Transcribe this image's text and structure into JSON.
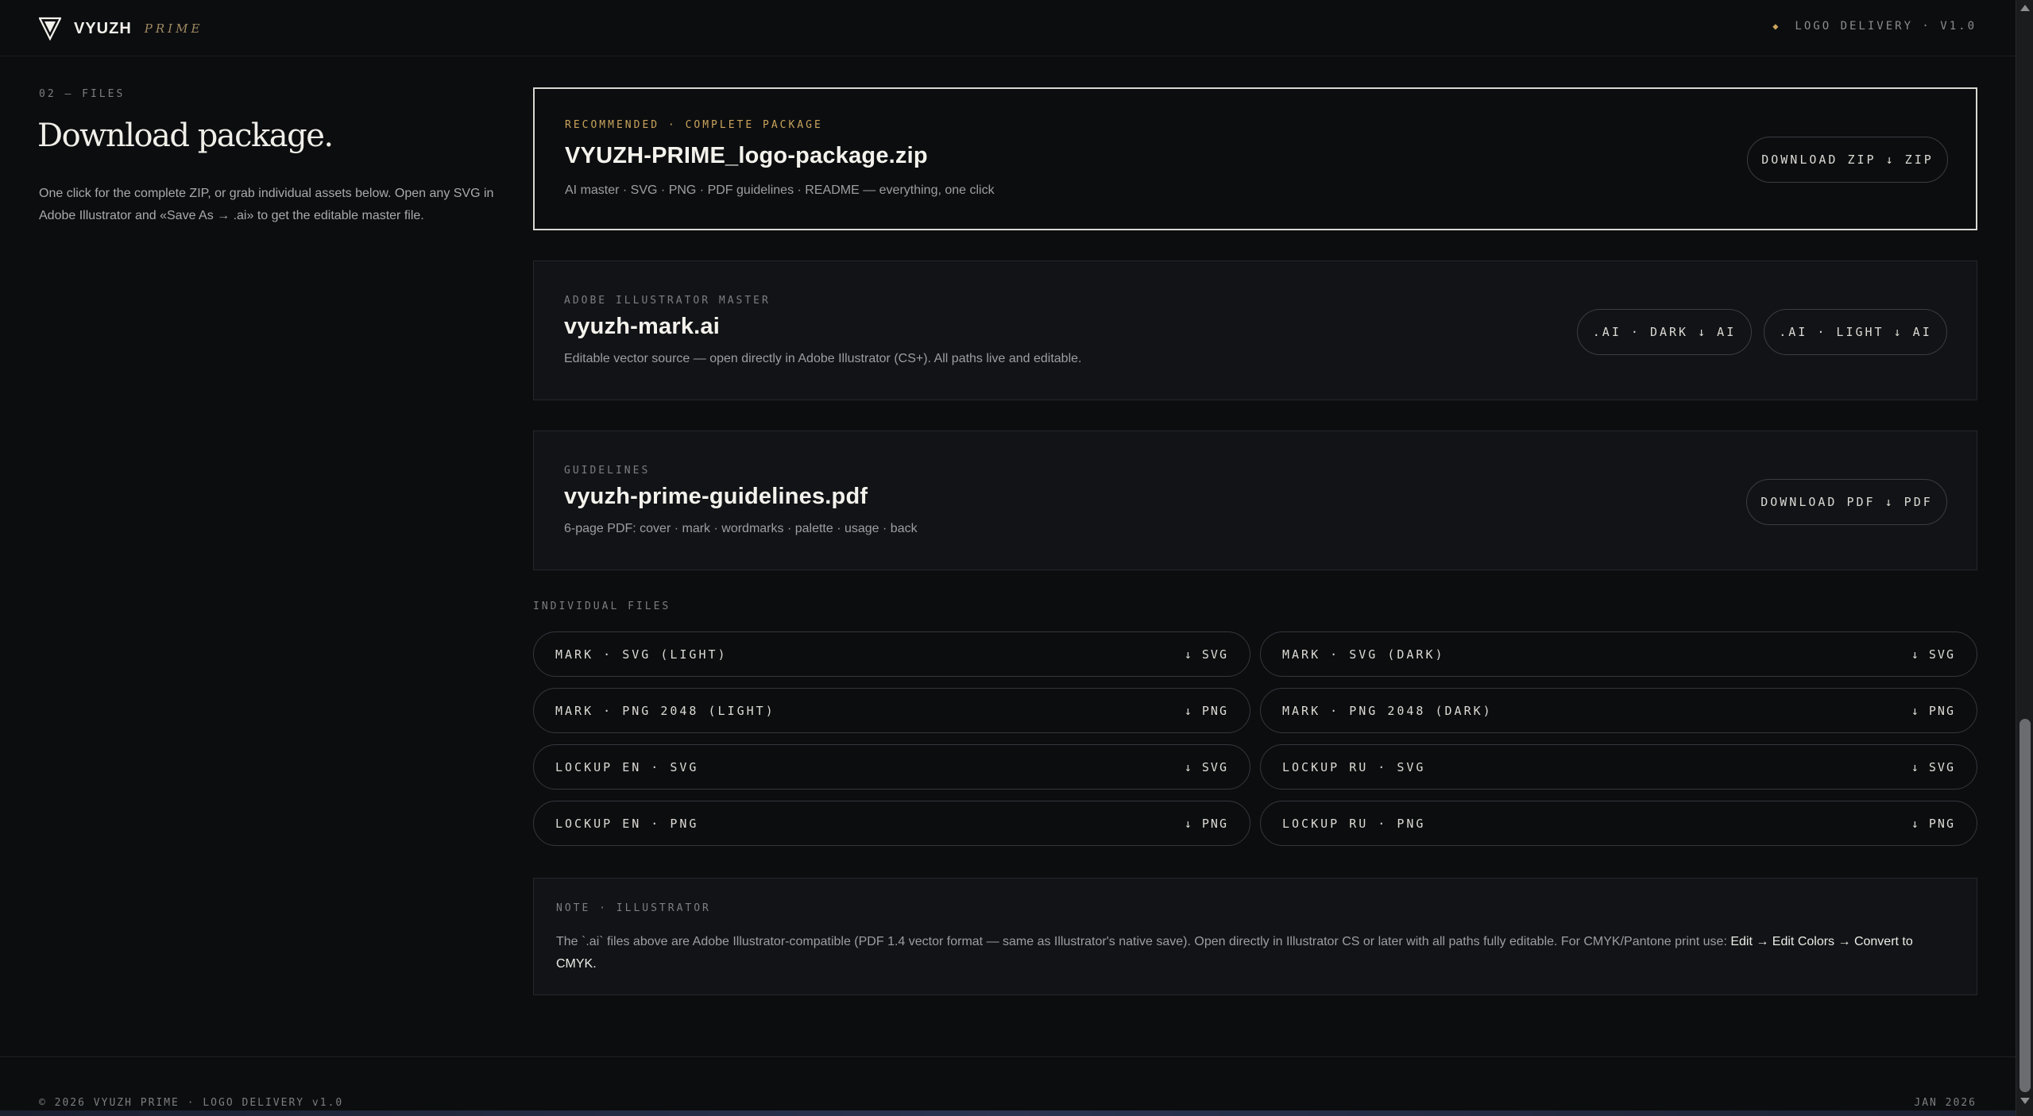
{
  "header": {
    "brand": "VYUZH",
    "brand_sub": "PRIME",
    "delivery_label": "LOGO DELIVERY · V1.0",
    "accent_color": "#c9a45c"
  },
  "intro": {
    "section_number": "02 — FILES",
    "title": "Download package.",
    "description": "One click for the complete ZIP, or grab individual assets below. Open any SVG in Adobe Illustrator and «Save As → .ai» to get the editable master file."
  },
  "package": {
    "eyebrow": "RECOMMENDED · COMPLETE PACKAGE",
    "filename": "VYUZH-PRIME_logo-package.zip",
    "description": "AI master · SVG · PNG · PDF guidelines · README — everything, one click",
    "button": "DOWNLOAD ZIP ↓ ZIP"
  },
  "illustrator": {
    "eyebrow": "ADOBE ILLUSTRATOR MASTER",
    "filename": "vyuzh-mark.ai",
    "description": "Editable vector source — open directly in Adobe Illustrator (CS+). All paths live and editable.",
    "button_dark": ".AI · DARK ↓ AI",
    "button_light": ".AI · LIGHT ↓ AI"
  },
  "guidelines": {
    "eyebrow": "GUIDELINES",
    "filename": "vyuzh-prime-guidelines.pdf",
    "description": "6-page PDF: cover · mark · wordmarks · palette · usage · back",
    "button": "DOWNLOAD PDF ↓ PDF"
  },
  "individual": {
    "label": "INDIVIDUAL FILES",
    "files": [
      {
        "name": "MARK · SVG (LIGHT)",
        "format": "↓ SVG"
      },
      {
        "name": "MARK · SVG (DARK)",
        "format": "↓ SVG"
      },
      {
        "name": "MARK · PNG 2048 (LIGHT)",
        "format": "↓ PNG"
      },
      {
        "name": "MARK · PNG 2048 (DARK)",
        "format": "↓ PNG"
      },
      {
        "name": "LOCKUP EN · SVG",
        "format": "↓ SVG"
      },
      {
        "name": "LOCKUP RU · SVG",
        "format": "↓ SVG"
      },
      {
        "name": "LOCKUP EN · PNG",
        "format": "↓ PNG"
      },
      {
        "name": "LOCKUP RU · PNG",
        "format": "↓ PNG"
      }
    ]
  },
  "note": {
    "eyebrow": "NOTE · ILLUSTRATOR",
    "text": "The `.ai` files above are Adobe Illustrator-compatible (PDF 1.4 vector format — same as Illustrator's native save). Open directly in Illustrator CS or later with all paths fully editable. For CMYK/Pantone print use: ",
    "emphasis": "Edit → Edit Colors → Convert to CMYK."
  },
  "footer": {
    "left": "© 2026 VYUZH PRIME · LOGO DELIVERY v1.0",
    "right": "JAN 2026"
  }
}
